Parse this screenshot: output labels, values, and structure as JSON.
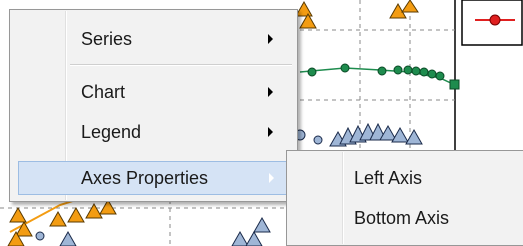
{
  "context_menu": {
    "items": [
      {
        "label": "Series",
        "has_submenu": true
      },
      {
        "label": "Chart",
        "has_submenu": true
      },
      {
        "label": "Legend",
        "has_submenu": true
      },
      {
        "label": "Axes Properties",
        "has_submenu": true,
        "highlighted": true
      }
    ]
  },
  "submenu": {
    "items": [
      {
        "label": "Left Axis"
      },
      {
        "label": "Bottom Axis"
      }
    ]
  },
  "colors": {
    "menu_bg": "#f2f2f2",
    "highlight": "#d5e3f5",
    "series_orange": "#f39c12",
    "series_green": "#1e8c4e",
    "series_blue": "#9fb6d6",
    "series_red": "#e02020"
  }
}
